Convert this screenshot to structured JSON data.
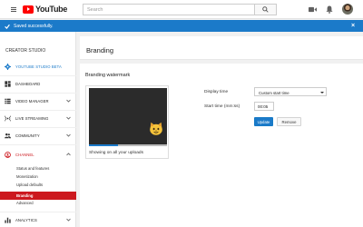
{
  "header": {
    "logo_text": "YouTube",
    "search_placeholder": "Search"
  },
  "notification": {
    "text": "Saved successfully.",
    "close": "×"
  },
  "sidebar": {
    "heading": "CREATOR STUDIO",
    "items": [
      {
        "label": "YOUTUBE STUDIO BETA",
        "icon": "gear-icon"
      },
      {
        "label": "DASHBOARD",
        "icon": "dashboard-icon"
      },
      {
        "label": "VIDEO MANAGER",
        "icon": "video-manager-icon"
      },
      {
        "label": "LIVE STREAMING",
        "icon": "live-streaming-icon"
      },
      {
        "label": "COMMUNITY",
        "icon": "community-icon"
      },
      {
        "label": "CHANNEL",
        "icon": "channel-icon"
      },
      {
        "label": "ANALYTICS",
        "icon": "analytics-icon"
      }
    ],
    "channel_subitems": [
      "Status and features",
      "Monetization",
      "Upload defaults",
      "Branding",
      "Advanced"
    ]
  },
  "main": {
    "page_title": "Branding",
    "section_title": "Branding watermark",
    "player_caption": "Showing on all your uploads",
    "video_progress": 0.37,
    "display_time_label": "Display time",
    "display_time_value": "Custom start time",
    "start_time_label": "Start time (mm:ss)",
    "start_time_value": "00:05",
    "update_button": "Update",
    "remove_button": "Remove"
  },
  "colors": {
    "brand_red": "#ff0000",
    "accent_blue": "#1b7ac9",
    "active_red": "#cc181e"
  }
}
